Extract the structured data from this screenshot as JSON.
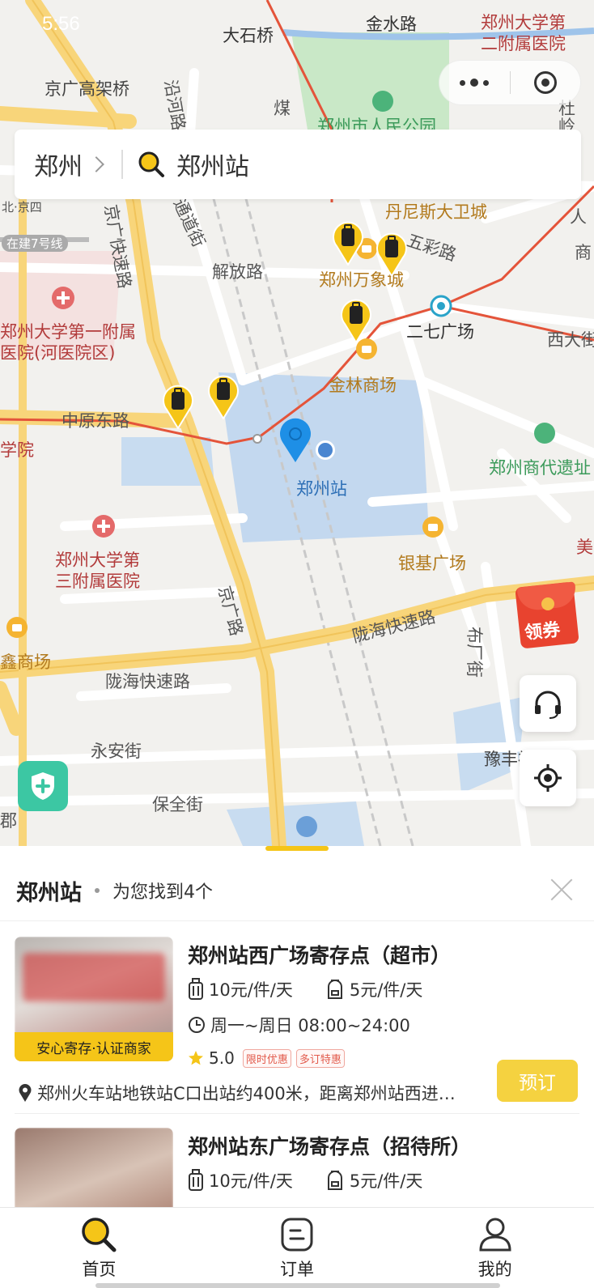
{
  "status_bar": {
    "time": "5:56"
  },
  "capsule": {
    "more_icon": "more-dots-icon",
    "close_icon": "miniapp-close-icon"
  },
  "search": {
    "city": "郑州",
    "query": "郑州站"
  },
  "map": {
    "labels": {
      "dashiqiao": "大石桥",
      "jinshui": "金水路",
      "hosp2": "郑州大学第",
      "hosp2b": "二附属医院",
      "jingguang_viaduct": "京广高架桥",
      "yanhe": "沿河路",
      "mei": "煤",
      "du": "杜",
      "ling": "岭",
      "park": "郑州市人民公园",
      "xingzhu": "北·京四",
      "line7": "在建7号线",
      "jingguang_express": "京广快速路",
      "jiefang": "解放路",
      "daniesi": "丹尼斯大卫城",
      "wancheng": "郑州万象城",
      "wucai": "五彩路",
      "ren": "人",
      "shang": "商",
      "erqi": "二七广场",
      "xida": "西大街",
      "hosp1": "郑州大学第一附属",
      "hosp1b": "医院(河医院区)",
      "jinlin": "金林商场",
      "zhongyuan_east": "中原东路",
      "xueyuan": "学院",
      "station": "郑州站",
      "shangdai": "郑州商代遗址",
      "hosp3": "郑州大学第",
      "hosp3b": "三附属医院",
      "yinji": "银基广场",
      "mei2": "美",
      "jingguang_road": "京广路",
      "longhai_express": "陇海快速路",
      "longhai_express2": "陇海快速路",
      "xin": "鑫商场",
      "buchang": "布厂街",
      "yongan": "永安街",
      "yufeng": "豫丰社区",
      "baoquan": "保全街",
      "jun": "郡",
      "tong": "通道街"
    }
  },
  "coupon": {
    "label": "领券"
  },
  "sheet": {
    "location": "郑州站",
    "result_text": "为您找到4个",
    "cards": [
      {
        "title": "郑州站西广场寄存点（超市）",
        "badge": "安心寄存·认证商家",
        "price_large": "10元/件/天",
        "price_small": "5元/件/天",
        "hours": "周一~周日 08:00~24:00",
        "rating": "5.0",
        "tags": [
          "限时优惠",
          "多订特惠"
        ],
        "address": "郑州火车站地铁站C口出站约400米，距离郑州站西进…",
        "book": "预订"
      },
      {
        "title": "郑州站东广场寄存点（招待所）",
        "price_large": "10元/件/天",
        "price_small": "5元/件/天"
      }
    ]
  },
  "tabbar": {
    "tabs": [
      {
        "label": "首页",
        "icon": "search-icon"
      },
      {
        "label": "订单",
        "icon": "order-icon"
      },
      {
        "label": "我的",
        "icon": "user-icon"
      }
    ]
  },
  "colors": {
    "accent": "#f5c518",
    "book_button": "#f5d240",
    "road_major": "#f8d57a",
    "metro_line": "#e4543a",
    "water": "#c3d8ef",
    "park": "#c9e8c7"
  }
}
